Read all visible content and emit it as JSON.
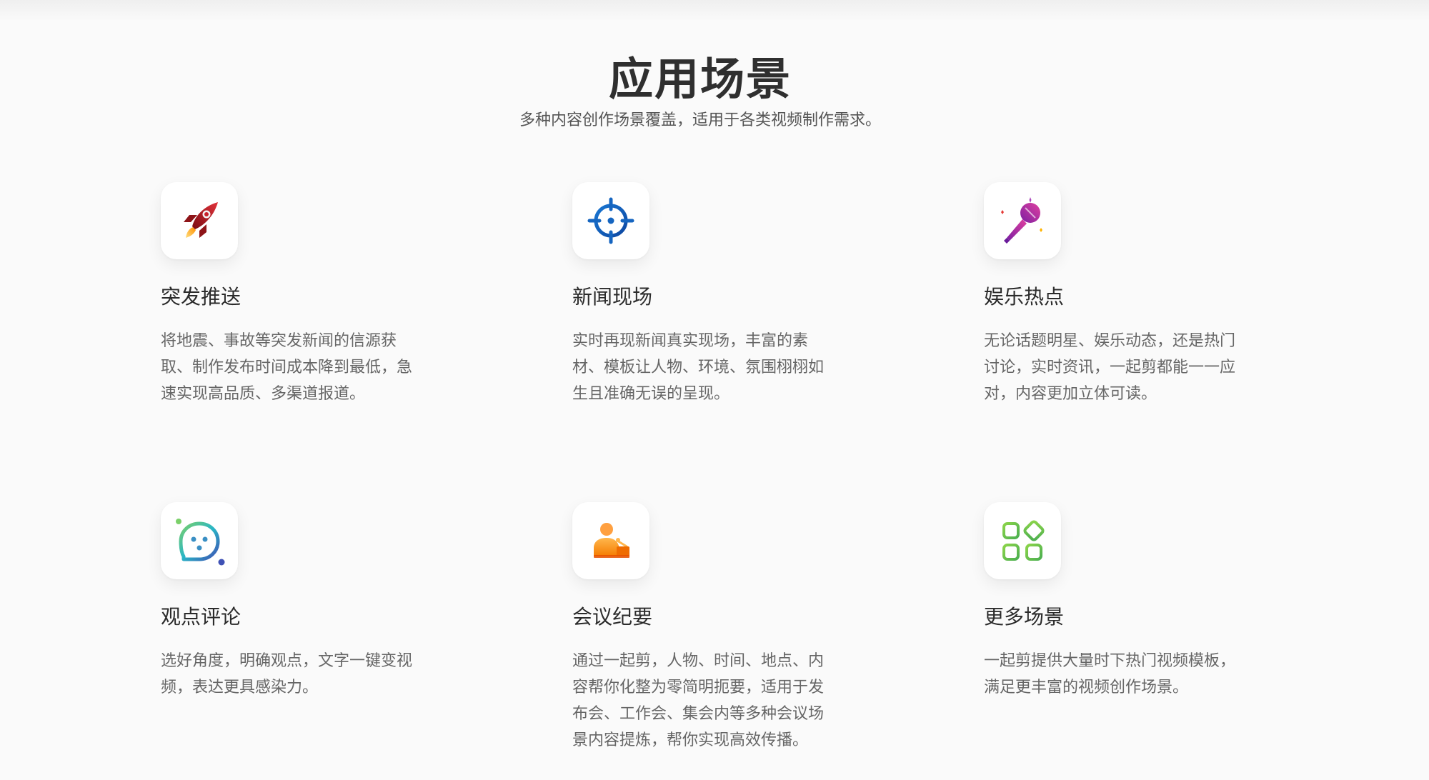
{
  "section": {
    "title": "应用场景",
    "subtitle": "多种内容创作场景覆盖，适用于各类视频制作需求。"
  },
  "cards": [
    {
      "icon": "rocket-icon",
      "title": "突发推送",
      "description": "将地震、事故等突发新闻的信源获取、制作发布时间成本降到最低，急速实现高品质、多渠道报道。"
    },
    {
      "icon": "crosshair-target-icon",
      "title": "新闻现场",
      "description": "实时再现新闻真实现场，丰富的素材、模板让人物、环境、氛围栩栩如生且准确无误的呈现。"
    },
    {
      "icon": "microphone-icon",
      "title": "娱乐热点",
      "description": "无论话题明星、娱乐动态，还是热门讨论，实时资讯，一起剪都能一一应对，内容更加立体可读。"
    },
    {
      "icon": "chat-bubble-face-icon",
      "title": "观点评论",
      "description": "选好角度，明确观点，文字一键变视频，表达更具感染力。"
    },
    {
      "icon": "meeting-speaker-icon",
      "title": "会议纪要",
      "description": "通过一起剪，人物、时间、地点、内容帮你化整为零简明扼要，适用于发布会、工作会、集会内等多种会议场景内容提炼，帮你实现高效传播。"
    },
    {
      "icon": "app-grid-icon",
      "title": "更多场景",
      "description": "一起剪提供大量时下热门视频模板，满足更丰富的视频创作场景。"
    }
  ],
  "colors": {
    "background": "#fafafa",
    "title": "#2f2f2f",
    "description": "#666666",
    "rocket": "#c8202a",
    "target": "#1565c0",
    "microphone": "#c02fb5",
    "chat": "#3f51b5",
    "meeting": "#f57c00",
    "grid": "#6ac13f"
  }
}
